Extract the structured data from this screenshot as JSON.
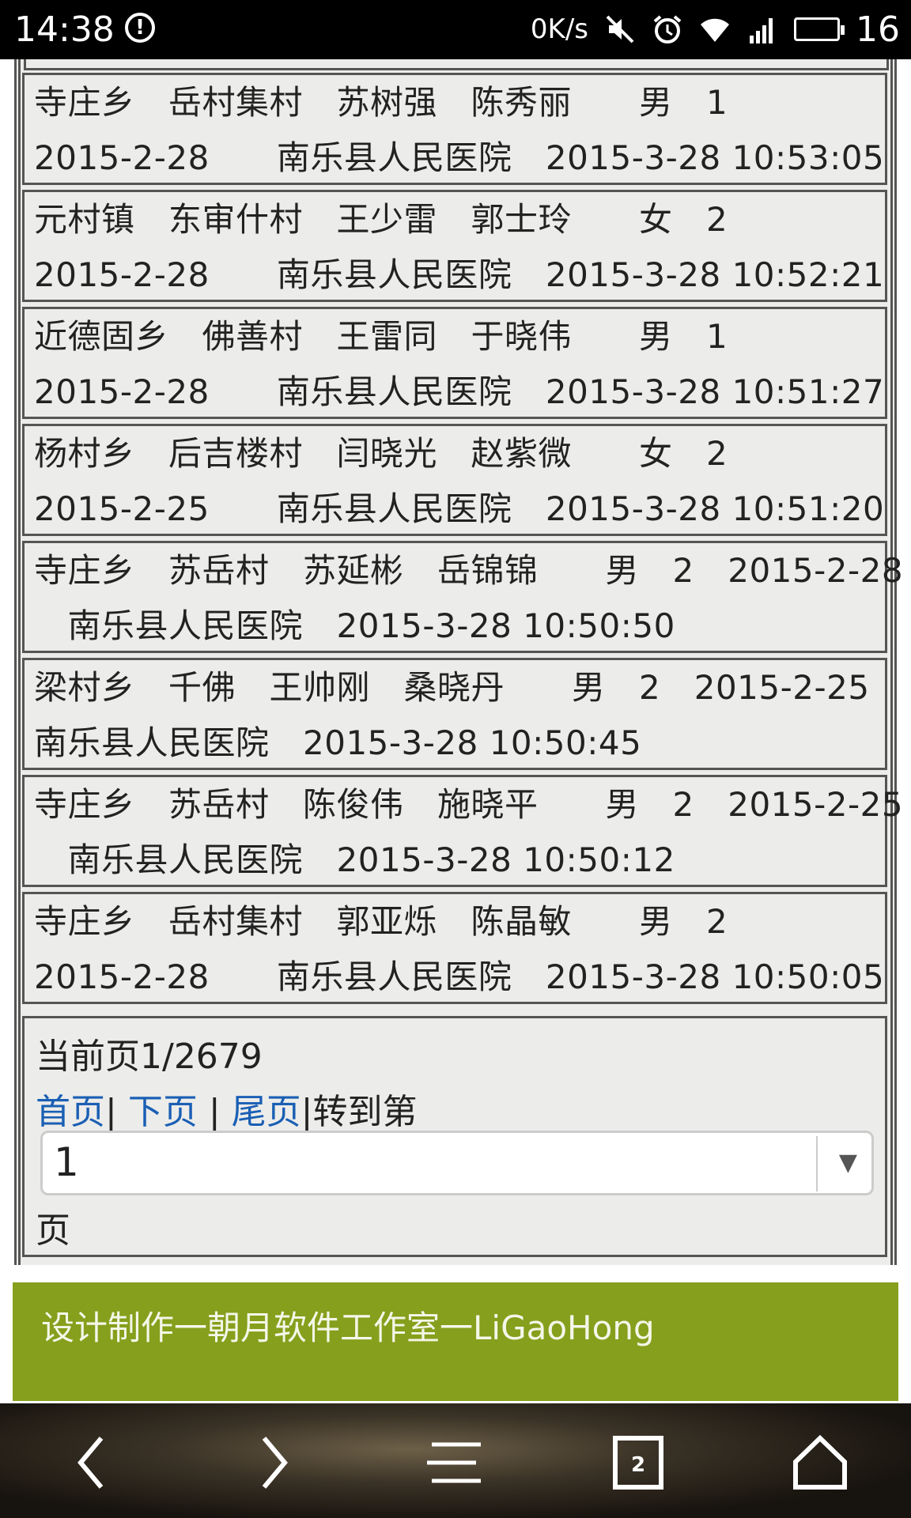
{
  "status_bar": {
    "time": "14:38",
    "alert_icon": "exclamation-circle-icon",
    "net_speed": "0K/s",
    "icons": [
      "mute-icon",
      "alarm-icon",
      "wifi-icon",
      "3g-signal-icon",
      "battery-icon"
    ],
    "battery": "16"
  },
  "records": [
    {
      "l1": "寺庄乡　岳村集村　苏树强　陈秀丽　　男　1",
      "l2": "2015-2-28　　南乐县人民医院　2015-3-28 10:53:05"
    },
    {
      "l1": "元村镇　东审什村　王少雷　郭士玲　　女　2",
      "l2": "2015-2-28　　南乐县人民医院　2015-3-28 10:52:21"
    },
    {
      "l1": "近德固乡　佛善村　王雷同　于晓伟　　男　1",
      "l2": "2015-2-28　　南乐县人民医院　2015-3-28 10:51:27"
    },
    {
      "l1": "杨村乡　后吉楼村　闫晓光　赵紫微　　女　2",
      "l2": "2015-2-25　　南乐县人民医院　2015-3-28 10:51:20"
    },
    {
      "l1": "寺庄乡　苏岳村　苏延彬　岳锦锦　　男　2　2015-2-28",
      "l2": "　南乐县人民医院　2015-3-28 10:50:50"
    },
    {
      "l1": "梁村乡　千佛　王帅刚　桑晓丹　　男　2　2015-2-25",
      "l2": "南乐县人民医院　2015-3-28 10:50:45"
    },
    {
      "l1": "寺庄乡　苏岳村　陈俊伟　施晓平　　男　2　2015-2-25",
      "l2": "　南乐县人民医院　2015-3-28 10:50:12"
    },
    {
      "l1": "寺庄乡　岳村集村　郭亚烁　陈晶敏　　男　2",
      "l2": "2015-2-28　　南乐县人民医院　2015-3-28 10:50:05"
    }
  ],
  "pager": {
    "current_page": "当前页1/2679",
    "first_link": "首页",
    "sep1": "|",
    "next_link": "下页",
    "sep2": "|",
    "last_link": "尾页",
    "goto_text": "|转到第",
    "select_value": "1",
    "page_suffix": "页"
  },
  "footer": {
    "text": "设计制作一朝月软件工作室一LiGaoHong",
    "color": "#869f1c"
  },
  "nav_bar": {
    "icons": [
      "back-icon",
      "forward-icon",
      "menu-icon",
      "tabs-icon",
      "home-icon"
    ],
    "tab_count": "2"
  }
}
